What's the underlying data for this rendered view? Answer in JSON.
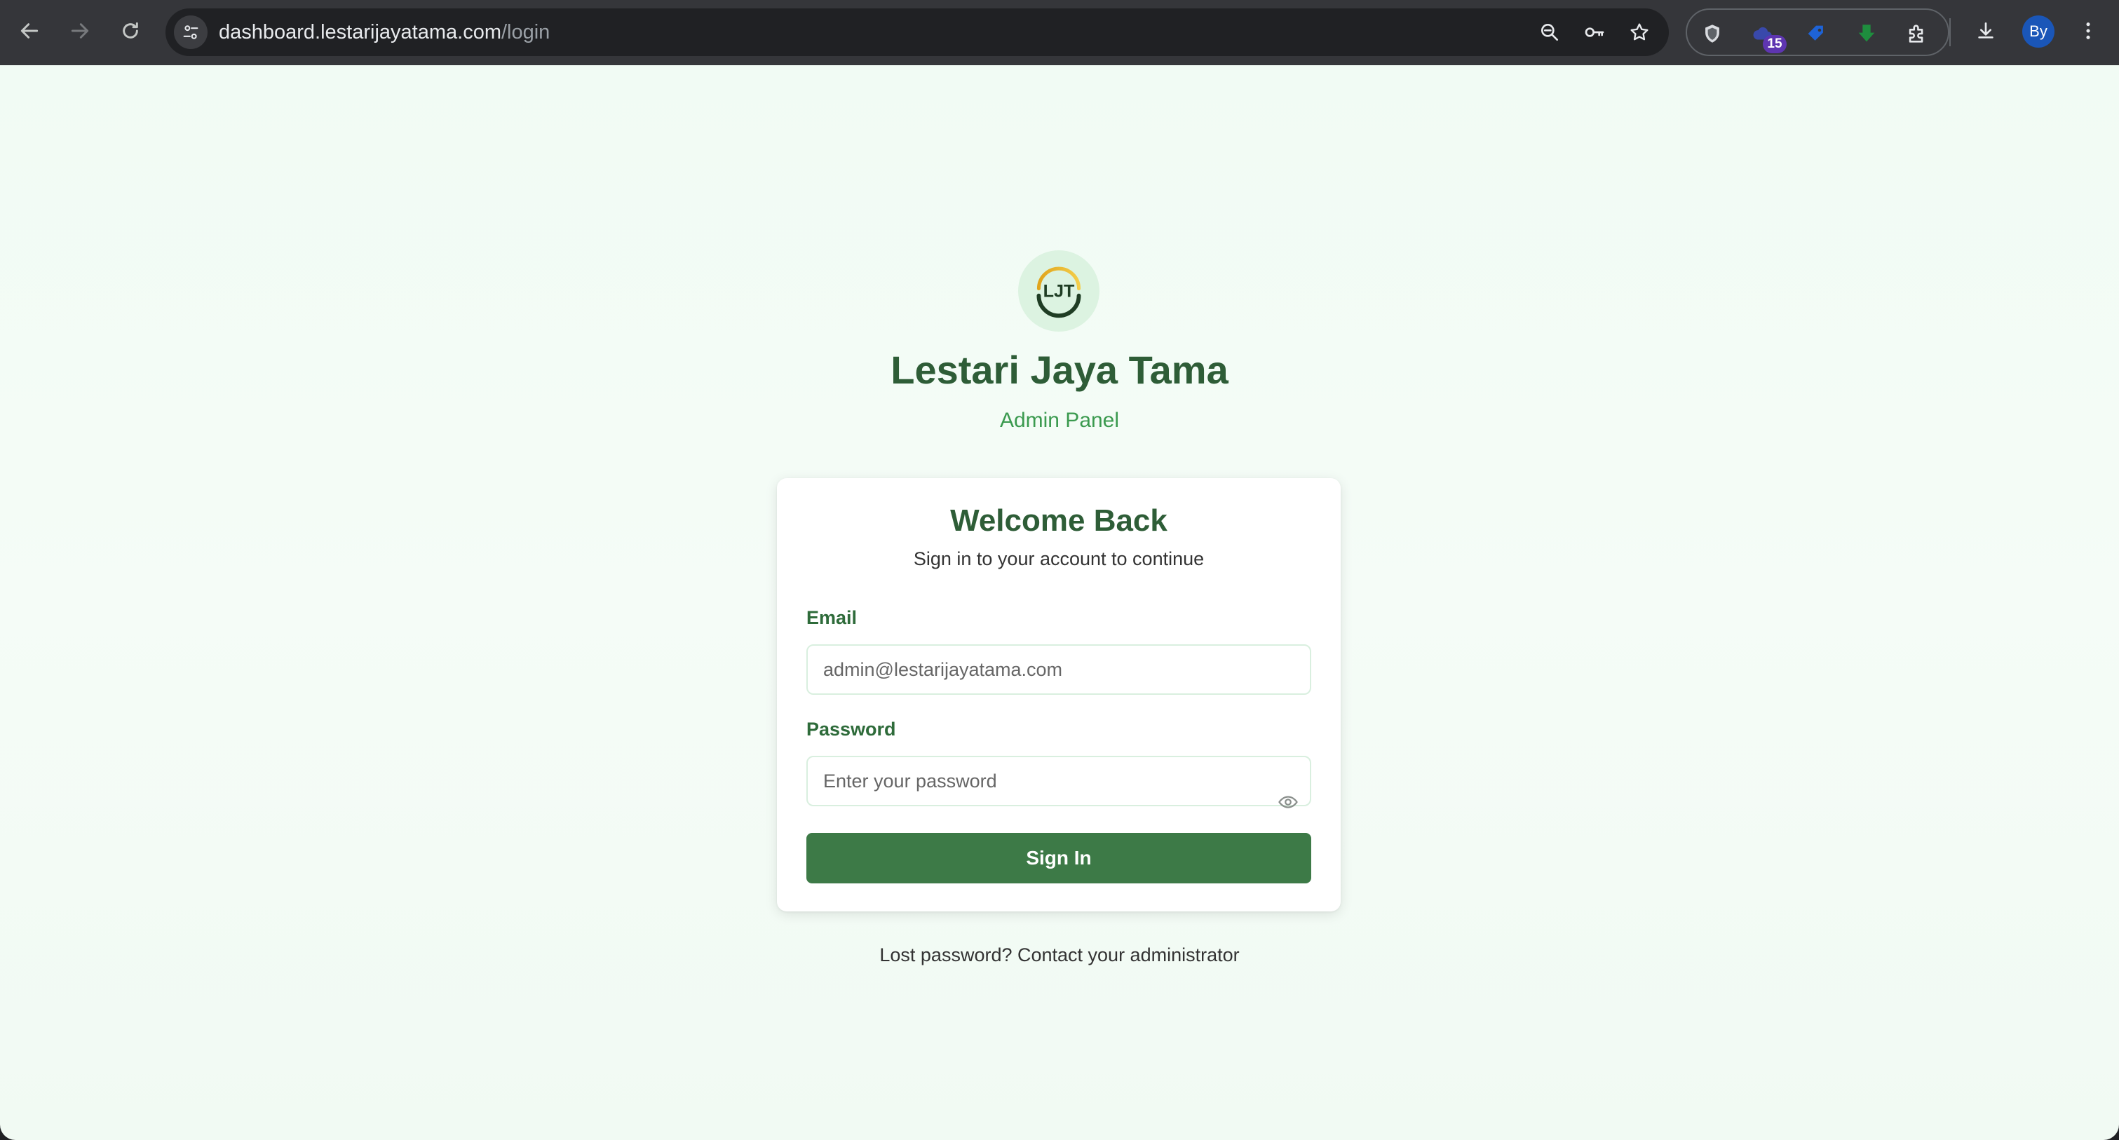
{
  "browser": {
    "url_host": "dashboard.lestarijayatama.com",
    "url_path": "/login",
    "extension_badge": "15",
    "profile_initials": "By",
    "icons": {
      "back": "arrow-left-icon",
      "forward": "arrow-right-icon",
      "reload": "reload-icon",
      "site_info": "tune-icon",
      "zoom": "zoom-out-icon",
      "password": "key-icon",
      "bookmark": "star-icon",
      "download": "download-icon",
      "menu": "kebab-menu-icon"
    }
  },
  "brand": {
    "logo_text": "LJT",
    "title": "Lestari Jaya Tama",
    "subtitle": "Admin Panel"
  },
  "login": {
    "title": "Welcome Back",
    "subtitle": "Sign in to your account to continue",
    "email_label": "Email",
    "email_placeholder": "admin@lestarijayatama.com",
    "password_label": "Password",
    "password_placeholder": "Enter your password",
    "submit_label": "Sign In",
    "lost_password": "Lost password? Contact your administrator"
  },
  "colors": {
    "primary": "#3d7a47",
    "heading": "#2e5d37",
    "accent": "#3b9a4f",
    "page_background": "#f3fbf5"
  }
}
